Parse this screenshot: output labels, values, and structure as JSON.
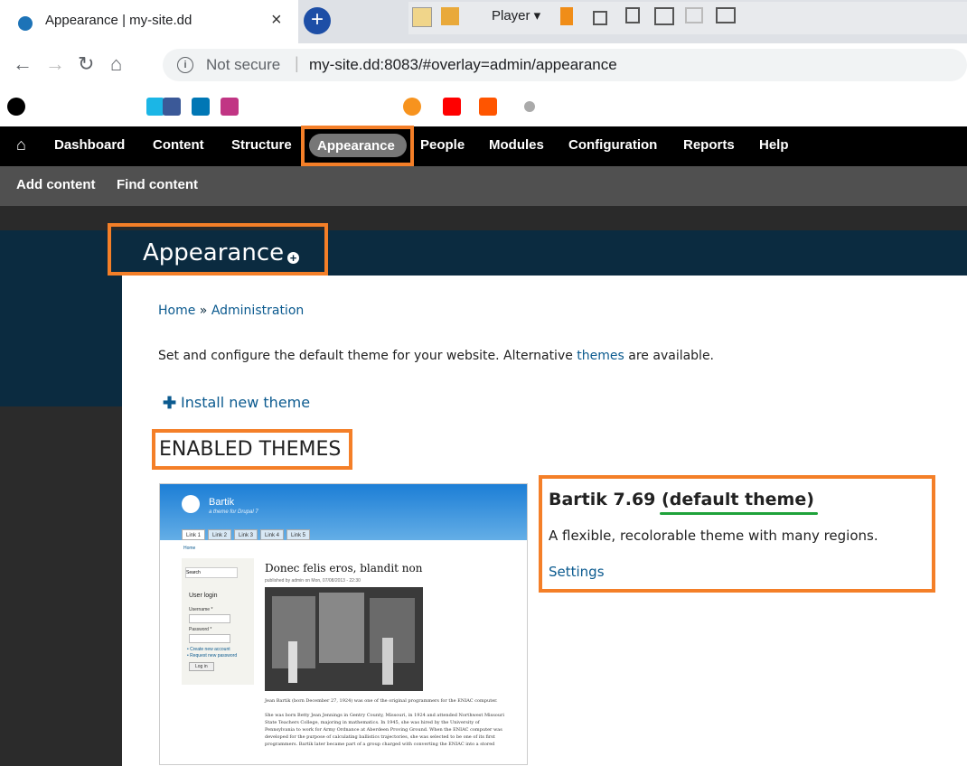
{
  "browser": {
    "tab_title": "Appearance | my-site.dd",
    "tab_close": "×",
    "new_tab": "+",
    "player_label": "Player ▾",
    "not_secure": "Not secure",
    "url": "my-site.dd:8083/#overlay=admin/appearance",
    "url_separator": "|"
  },
  "admin_menu": {
    "items": [
      "Dashboard",
      "Content",
      "Structure",
      "Appearance",
      "People",
      "Modules",
      "Configuration",
      "Reports",
      "Help"
    ],
    "active": "Appearance"
  },
  "shortcuts": [
    "Add content",
    "Find content"
  ],
  "page": {
    "title": "Appearance",
    "breadcrumb": {
      "home": "Home",
      "sep": " » ",
      "admin": "Administration"
    },
    "intro_before": "Set and configure the default theme for your website. Alternative ",
    "intro_link": "themes",
    "intro_after": " are available.",
    "install_link": "Install new theme",
    "enabled_heading": "ENABLED THEMES"
  },
  "theme": {
    "name": "Bartik 7.69",
    "default_label": "(default theme)",
    "description": "A flexible, recolorable theme with many regions.",
    "settings_link": "Settings"
  },
  "preview": {
    "site_name": "Bartik",
    "slogan": "a theme for Drupal 7",
    "tabs": [
      "Link 1",
      "Link 2",
      "Link 3",
      "Link 4",
      "Link 5"
    ],
    "home": "Home",
    "search": "Search",
    "user_login": "User login",
    "username": "Username *",
    "password": "Password *",
    "create_account": "• Create new account",
    "request_password": "• Request new password",
    "login_button": "Log in",
    "article_title": "Donec felis eros, blandit non",
    "meta": "published by admin on Mon, 07/08/2013 - 22:30",
    "body1": "Jean Bartik (born December 27, 1924) was one of the original programmers for the ENIAC computer.",
    "body2": "She was born Betty Jean Jennings in Gentry County, Missouri, in 1924 and attended Northwest Missouri State Teachers College, majoring in mathematics. In 1945, she was hired by the University of Pennsylvania to work for Army Ordnance at Aberdeen Proving Ground. When the ENIAC computer was developed for the purpose of calculating ballistics trajectories, she was selected to be one of its first programmers. Bartik later became part of a group charged with converting the ENIAC into a stored"
  },
  "colors": {
    "highlight": "#f47f28",
    "underline": "#1fa23a",
    "link": "#0b5a8f",
    "header_bg": "#0b2b40"
  }
}
